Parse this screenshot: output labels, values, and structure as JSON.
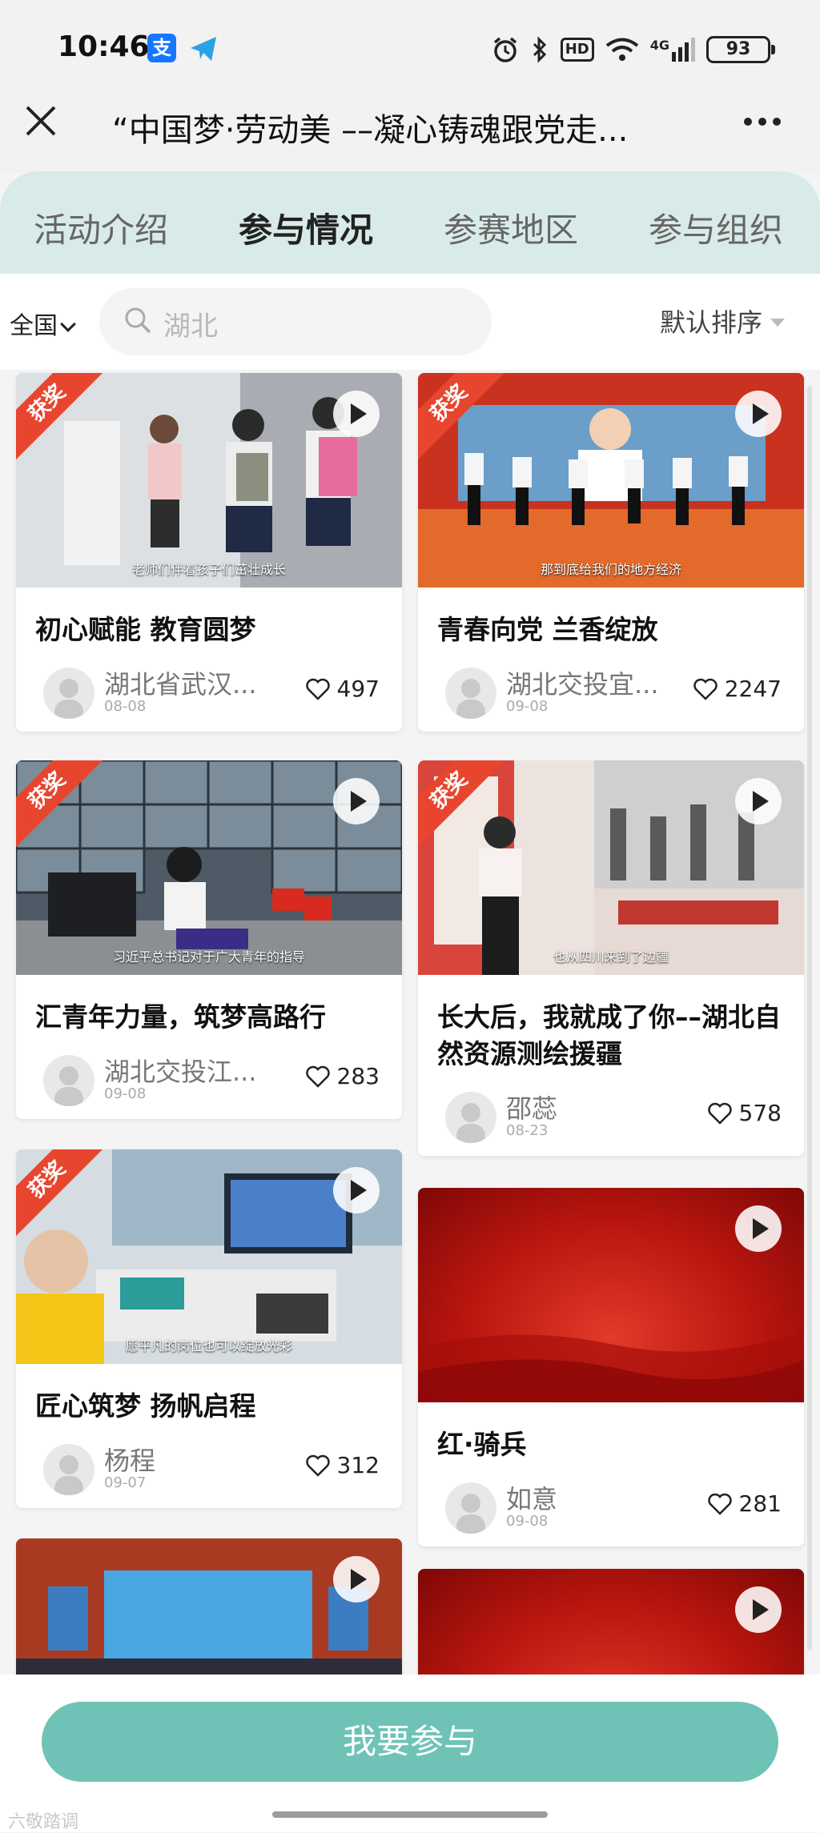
{
  "status": {
    "time": "10:46",
    "network": "4G",
    "battery": "93",
    "hd_label": "HD"
  },
  "nav": {
    "title": "“中国梦·劳动美 ––凝心铸魂跟党走..."
  },
  "tabs": [
    "活动介绍",
    "参与情况",
    "参赛地区",
    "参与组织"
  ],
  "active_tab": "参与情况",
  "filter": {
    "region": "全国",
    "search_value": "湖北",
    "sort": "默认排序"
  },
  "award_label": "获奖",
  "cards": [
    {
      "title": "初心赋能 教育圆梦",
      "author": "湖北省武汉...",
      "date": "08-08",
      "likes": "497",
      "awarded": true,
      "caption": "老师们伴着孩子们茁壮成长",
      "thumb_icon": "school-scene"
    },
    {
      "title": "青春向党 兰香绽放",
      "author": "湖北交投宜...",
      "date": "09-08",
      "likes": "2247",
      "awarded": true,
      "caption": "那到底给我们的地方经济",
      "thumb_icon": "stage-performance"
    },
    {
      "title": "汇青年力量，筑梦高路行",
      "author": "湖北交投江...",
      "date": "09-08",
      "likes": "283",
      "awarded": true,
      "caption": "习近平总书记对于广大青年的指导",
      "thumb_icon": "monitoring-room"
    },
    {
      "title": "长大后，我就成了你––湖北自然资源测绘援疆",
      "author": "邵蕊",
      "date": "08-23",
      "likes": "578",
      "awarded": true,
      "caption": "也从四川来到了边疆",
      "thumb_icon": "exhibition-hall"
    },
    {
      "title": "匠心筑梦 扬帆启程",
      "author": "杨程",
      "date": "09-07",
      "likes": "312",
      "awarded": true,
      "caption": "愿平凡的岗位也可以绽放光彩",
      "thumb_icon": "toll-booth"
    },
    {
      "title": "红·骑兵",
      "author": "如意",
      "date": "09-08",
      "likes": "281",
      "awarded": false,
      "caption": "",
      "thumb_icon": "red-background"
    },
    {
      "title": "",
      "author": "",
      "date": "",
      "likes": "",
      "awarded": false,
      "caption": "",
      "thumb_icon": "conference-stage"
    },
    {
      "title": "",
      "author": "",
      "date": "",
      "likes": "",
      "awarded": false,
      "caption": "",
      "thumb_icon": "red-background"
    }
  ],
  "join_button": "我要参与",
  "watermark": "六敬踏调",
  "colors": {
    "tab_bg": "#d8ebe8",
    "accent": "#6ec3b6",
    "award": "#e8452e"
  }
}
